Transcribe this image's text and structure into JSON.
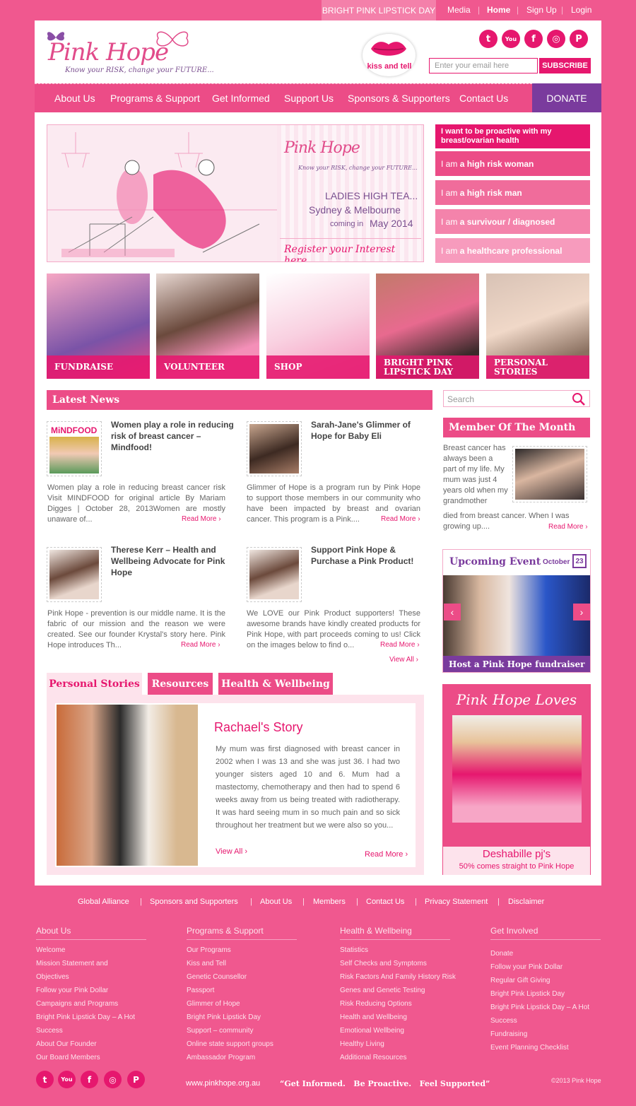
{
  "topbar": {
    "campaign": "BRIGHT PINK LIPSTICK DAY",
    "links": [
      "Media",
      "Home",
      "Sign Up",
      "Login"
    ],
    "separator": "|"
  },
  "logo": {
    "title": "Pink Hope",
    "tagline": "Know your RISK, change your FUTURE..."
  },
  "kiss_badge": "kiss and tell",
  "social": [
    "twitter-icon",
    "youtube-icon",
    "facebook-icon",
    "instagram-icon",
    "pinterest-icon"
  ],
  "subscribe": {
    "placeholder": "Enter your email here",
    "button": "SUBSCRIBE"
  },
  "nav": {
    "items": [
      "About Us",
      "Programs & Support",
      "Get Informed",
      "Support Us",
      "Sponsors & Supporters",
      "Contact Us"
    ],
    "donate": "DONATE"
  },
  "hero": {
    "logo_title": "Pink Hope",
    "logo_tagline": "Know your RISK, change your FUTURE...",
    "line1": "LADIES HIGH TEA...",
    "line2": "Sydney & Melbourne",
    "line3a": "coming in",
    "line3b": "May 2014",
    "cta": "Register your Interest here..."
  },
  "side_menu": {
    "heading": "I want to be proactive with my breast/ovarian health",
    "items": [
      {
        "pre": "I am",
        "bold": "a high risk woman"
      },
      {
        "pre": "I am",
        "bold": "a high risk man"
      },
      {
        "pre": "I am",
        "bold": "a survivour / diagnosed"
      },
      {
        "pre": "I am",
        "bold": "a healthcare professional"
      }
    ]
  },
  "tiles": [
    {
      "caption": "FUNDRAISE"
    },
    {
      "caption": "VOLUNTEER"
    },
    {
      "caption": "SHOP"
    },
    {
      "caption": "BRIGHT PINK LIPSTICK DAY"
    },
    {
      "caption": "PERSONAL STORIES"
    }
  ],
  "news": {
    "heading": "Latest News",
    "read_more": "Read More",
    "view_all": "View All",
    "items": [
      {
        "title": "Women play a role in reducing risk of breast cancer – Mindfood!",
        "thumb_label": "MiNDFOOD",
        "body": "Women play a role in reducing breast cancer risk Visit MINDFOOD for original article  By Mariam Digges  | October 28, 2013Women are mostly unaware of..."
      },
      {
        "title": "Sarah-Jane's Glimmer of Hope for Baby Eli",
        "body": "Glimmer of Hope is a program run by Pink Hope to support those members in our community who have been impacted by breast and ovarian cancer. This program is a Pink...."
      },
      {
        "title": "Therese Kerr – Health and Wellbeing Advocate for Pink Hope",
        "body": "Pink Hope - prevention is our middle name. It is the fabric of our mission and the reason we were created. See our founder Krystal's story here. Pink Hope introduces Th..."
      },
      {
        "title": "Support Pink Hope & Purchase a Pink Product!",
        "body": "We LOVE our Pink Product supporters! These awesome brands have kindly created products for Pink Hope, with part proceeds coming to us! Click on the images below to find o..."
      }
    ]
  },
  "search": {
    "placeholder": "Search"
  },
  "member": {
    "heading": "Member Of The Month",
    "text_short": "Breast cancer has always been a part of my life. My mum was just 4 years old when my grandmother",
    "text_long": "died from breast cancer. When I was growing up....",
    "read_more": "Read More"
  },
  "event": {
    "heading": "Upcoming Event",
    "month": "October",
    "day": "23",
    "caption": "Host a Pink Hope fundraiser"
  },
  "loves": {
    "heading": "Pink Hope Loves",
    "product": "Deshabille pj's",
    "sub": "50% comes straight to Pink Hope"
  },
  "tabs": {
    "items": [
      "Personal Stories",
      "Resources",
      "Health & Wellbeing"
    ],
    "story_title": "Rachael's Story",
    "story_body": "My mum was first diagnosed with breast cancer in 2002 when I was 13 and she was just 36. I had two younger sisters aged 10 and 6. Mum had a mastectomy, chemotherapy and then had to spend 6 weeks away from us being treated with radiotherapy. It was hard seeing mum in so much pain and so sick throughout her treatment but we were also so you...",
    "view_all": "View All",
    "read_more": "Read More"
  },
  "footer": {
    "nav": [
      "Global Alliance",
      "Sponsors and Supporters",
      "About Us",
      "Members",
      "Contact Us",
      "Privacy Statement",
      "Disclaimer"
    ],
    "columns": [
      {
        "heading": "About Us",
        "links": [
          "Welcome",
          "Mission Statement and Objectives",
          "Follow your Pink Dollar",
          "Campaigns and Programs",
          "Bright Pink Lipstick Day – A Hot Success",
          "About Our Founder",
          "Our Board Members"
        ]
      },
      {
        "heading": "Programs & Support",
        "links": [
          "Our Programs",
          "Kiss and Tell",
          "Genetic Counsellor",
          "Passport",
          "Glimmer of Hope",
          "Bright Pink Lipstick Day",
          "Support – community",
          "Online state support groups",
          "Ambassador Program"
        ]
      },
      {
        "heading": "Health & Wellbeing",
        "links": [
          "Statistics",
          "Self Checks and Symptoms",
          "Risk Factors And Family History Risk",
          "Genes and Genetic Testing",
          "Risk Reducing Options",
          "Health and Wellbeing",
          "Emotional Wellbeing",
          "Healthy Living",
          "Additional Resources"
        ]
      },
      {
        "heading": "Get Involved",
        "links": [
          "Donate",
          "Follow your Pink Dollar",
          "Regular Gift Giving",
          "Bright Pink Lipstick Day",
          "Bright Pink Lipstick Day – A Hot Success",
          "Fundraising",
          "Event Planning Checklist"
        ]
      }
    ],
    "url": "www.pinkhope.org.au",
    "slogan": "“Get Informed.   Be Proactive.   Feel Supported”",
    "copyright": "©2013 Pink Hope"
  }
}
